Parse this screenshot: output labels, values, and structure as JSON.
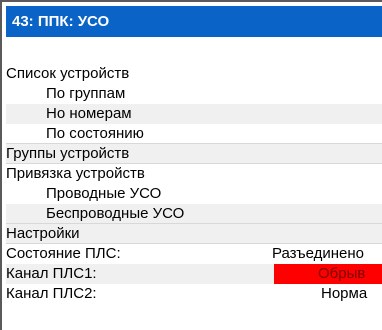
{
  "window": {
    "title": "43: ППК: УСО"
  },
  "menu": {
    "device_list": "Список устройств",
    "by_groups": "По группам",
    "by_numbers": "Но номерам",
    "by_state": "По состоянию",
    "device_groups": "Группы устройств",
    "device_binding": "Привязка устройств",
    "wired_uso": "Проводные УСО",
    "wireless_uso": "Беспроводные УСО",
    "settings": "Настройки",
    "pls_state_label": "Состояние ПЛС:",
    "pls_state_value": "Разъединено",
    "pls1_channel_label": "Канал ПЛС1:",
    "pls1_channel_value": "Обрыв",
    "pls2_channel_label": "Канал ПЛС2:",
    "pls2_channel_value": "Норма"
  },
  "colors": {
    "title_bar": "#0a63c6",
    "alarm": "#ff0000"
  }
}
